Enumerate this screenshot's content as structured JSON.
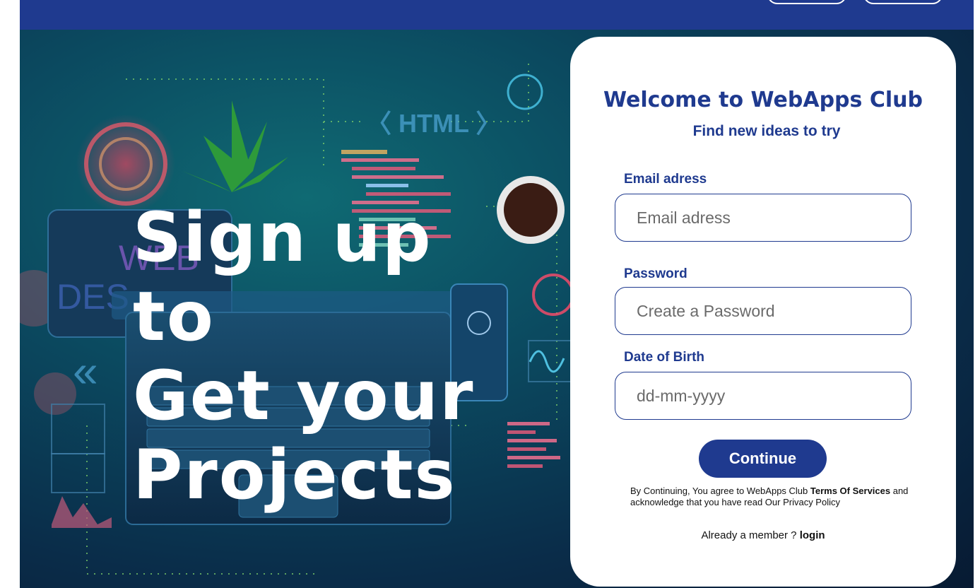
{
  "hero": {
    "headline_lines": [
      "Sign up",
      "to",
      "Get your",
      "Projects"
    ],
    "art_labels": {
      "html_tag": "HTML",
      "web": "WEB",
      "design": "DES"
    }
  },
  "signup": {
    "title": "Welcome to WebApps Club",
    "subtitle": "Find new ideas to try",
    "email": {
      "label": "Email adress",
      "placeholder": "Email adress",
      "value": ""
    },
    "password": {
      "label": "Password",
      "placeholder": "Create a Password",
      "value": ""
    },
    "dob": {
      "label": "Date of Birth",
      "placeholder": "dd-mm-yyyy",
      "value": ""
    },
    "continue_label": "Continue",
    "terms": {
      "prefix": "By Continuing, You agree to WebApps Club ",
      "link": "Terms Of Services",
      "suffix": " and acknowledge that you have read Our Privacy Policy"
    },
    "member": {
      "prefix": "Already a member ? ",
      "login_label": "login"
    }
  },
  "colors": {
    "brand": "#1f3a8f",
    "card": "#ffffff",
    "hero_dark": "#0a2c49",
    "hero_teal": "#0f6a73"
  }
}
